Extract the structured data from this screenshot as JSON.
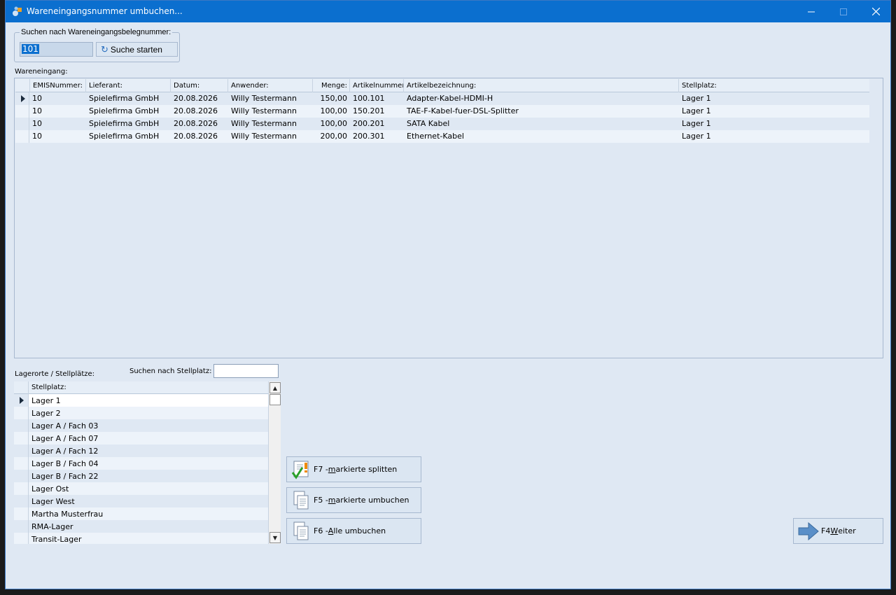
{
  "window": {
    "title": "Wareneingangsnummer umbuchen...",
    "controls": {
      "minimize": "—",
      "maximize": "☐",
      "close": "✕"
    }
  },
  "search": {
    "legend": "Suchen nach Wareneingangsbelegnummer:",
    "value": "101",
    "button_label": "Suche starten"
  },
  "wareneingang": {
    "label": "Wareneingang:",
    "columns": [
      "EMISNummer:",
      "Lieferant:",
      "Datum:",
      "Anwender:",
      "Menge:",
      "Artikelnummer",
      "Artikelbezeichnung:",
      "Stellplatz:"
    ],
    "rows": [
      [
        "10",
        "Spielefirma GmbH",
        "20.08.2026",
        "Willy Testermann",
        "150,00",
        "100.101",
        "Adapter-Kabel-HDMI-H",
        "Lager 1"
      ],
      [
        "10",
        "Spielefirma GmbH",
        "20.08.2026",
        "Willy Testermann",
        "100,00",
        "150.201",
        "TAE-F-Kabel-fuer-DSL-Splitter",
        "Lager 1"
      ],
      [
        "10",
        "Spielefirma GmbH",
        "20.08.2026",
        "Willy Testermann",
        "100,00",
        "200.201",
        "SATA Kabel",
        "Lager 1"
      ],
      [
        "10",
        "Spielefirma GmbH",
        "20.08.2026",
        "Willy Testermann",
        "200,00",
        "200.301",
        "Ethernet-Kabel",
        "Lager 1"
      ]
    ]
  },
  "lager": {
    "label": "Lagerorte / Stellplätze:",
    "search_label": "Suchen nach Stellplatz:",
    "search_value": "",
    "column": "Stellplatz:",
    "items": [
      "Lager 1",
      "Lager 2",
      "Lager A / Fach 03",
      "Lager A / Fach 07",
      "Lager A / Fach 12",
      "Lager B / Fach 04",
      "Lager B / Fach 22",
      "Lager Ost",
      "Lager West",
      "Martha Musterfrau",
      "RMA-Lager",
      "Transit-Lager"
    ]
  },
  "actions": {
    "split": {
      "prefix": "F7 - ",
      "mnemonic": "m",
      "rest": "arkierte splitten"
    },
    "umbuchen": {
      "prefix": "F5 - ",
      "mnemonic": "m",
      "rest": "arkierte umbuchen"
    },
    "alle": {
      "prefix": "F6 - ",
      "mnemonic": "A",
      "rest": "lle umbuchen"
    },
    "weiter": {
      "prefix": "F4 ",
      "mnemonic": "W",
      "rest": "eiter"
    }
  },
  "icons": {
    "app": "app-icon",
    "refresh": "refresh-icon",
    "split": "document-check-warning-icon",
    "umbuchen": "documents-icon",
    "alle": "documents-icon",
    "weiter": "arrow-right-icon"
  },
  "colors": {
    "titlebar": "#0b6fcf",
    "window_bg": "#dfe8f3",
    "selection": "#0b6fcf"
  }
}
